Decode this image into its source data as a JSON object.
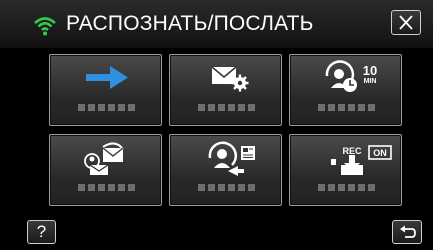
{
  "header": {
    "title": "РАСПОЗНАТЬ/ПОСЛАТЬ",
    "wifi_icon": "wifi-icon",
    "close_icon": "close-icon"
  },
  "tiles": [
    {
      "icon": "arrow-right-icon"
    },
    {
      "icon": "mail-settings-icon"
    },
    {
      "icon": "person-clock-10min-icon",
      "badge_value": "10",
      "badge_unit": "MIN"
    },
    {
      "icon": "contact-mail-icon"
    },
    {
      "icon": "person-send-photo-icon"
    },
    {
      "icon": "rec-on-icon",
      "badge_rec": "REC",
      "badge_on": "ON"
    }
  ],
  "footer": {
    "help_label": "?",
    "back_icon": "back-icon"
  },
  "colors": {
    "accent_green": "#35c94a",
    "arrow_blue": "#2f8fe0",
    "tile_border": "#9a9a9a"
  }
}
